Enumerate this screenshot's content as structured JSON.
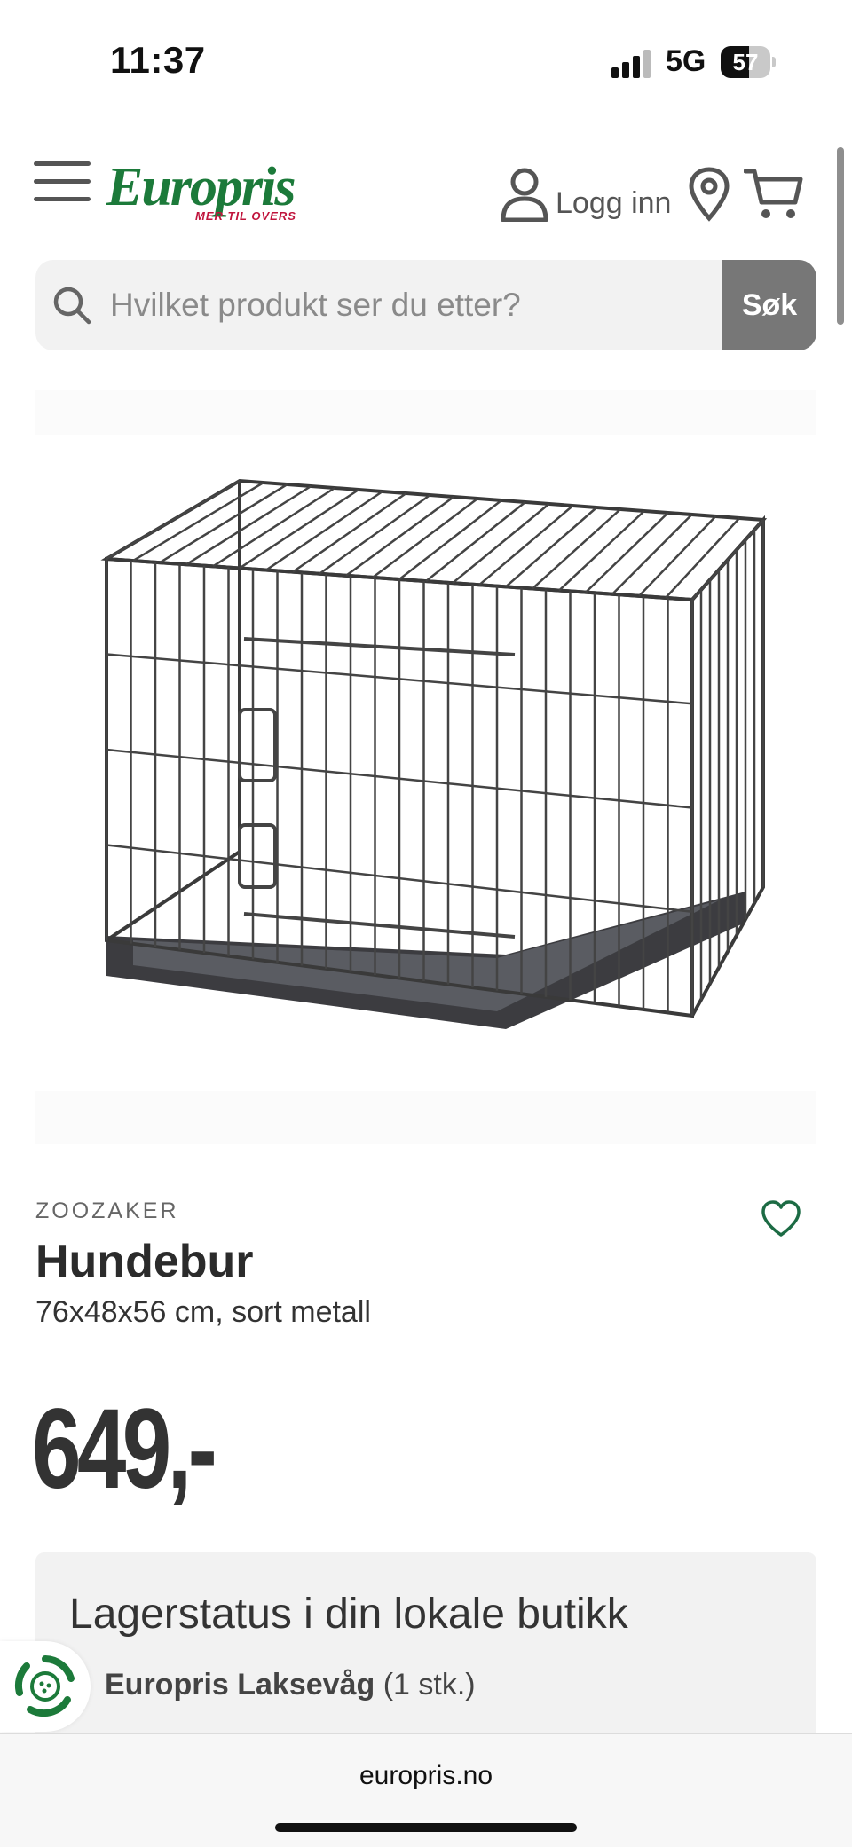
{
  "status_bar": {
    "time": "11:37",
    "network": "5G",
    "battery_percent": "57",
    "battery_level": 0.57
  },
  "header": {
    "logo_text": "Europris",
    "logo_tagline": "MER TIL OVERS",
    "login_label": "Logg inn",
    "brand_color": "#1c7a3a",
    "tagline_color": "#c0143c"
  },
  "search": {
    "placeholder": "Hvilket produkt ser du etter?",
    "button_label": "Søk"
  },
  "product": {
    "brand": "ZOOZAKER",
    "name": "Hundebur",
    "description": "76x48x56 cm, sort metall",
    "price": "649,-"
  },
  "stock": {
    "title": "Lagerstatus i din lokale butikk",
    "store_name": "Europris Laksevåg",
    "store_quantity": "(1 stk.)"
  },
  "browser": {
    "url": "europris.no"
  },
  "icons": [
    "menu-icon",
    "user-icon",
    "location-icon",
    "cart-icon",
    "search-icon",
    "heart-icon",
    "recycle-icon"
  ]
}
